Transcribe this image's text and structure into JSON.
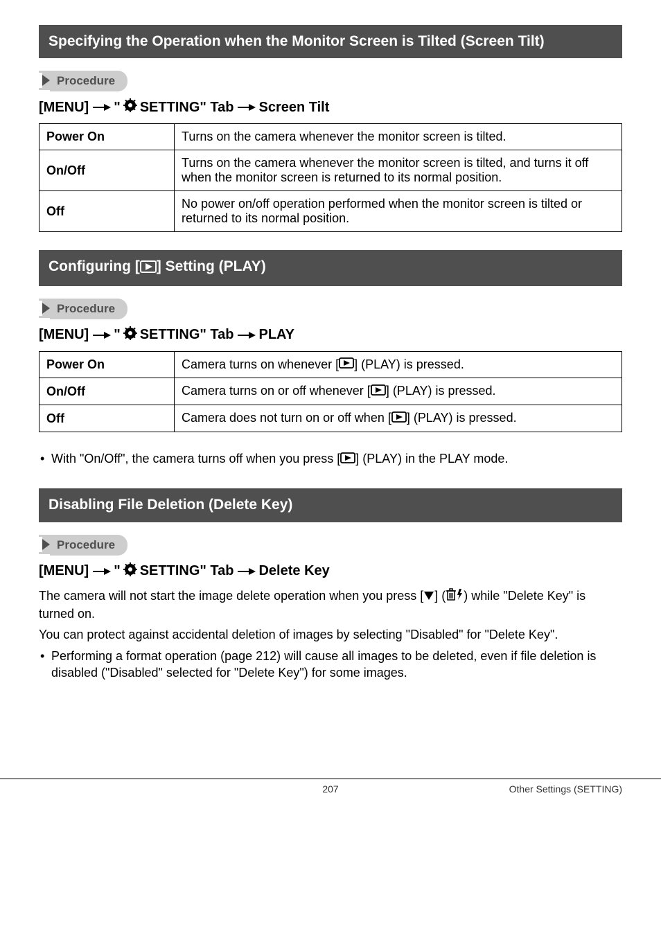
{
  "sec1": {
    "title": "Specifying the Operation when the Monitor Screen is Tilted (Screen Tilt)",
    "proc": "Procedure",
    "path_a": "[MENU]",
    "path_b": "\"",
    "path_c": " SETTING\" Tab",
    "path_d": "Screen Tilt",
    "rows": [
      {
        "k": "Power On",
        "v": "Turns on the camera whenever the monitor screen is tilted."
      },
      {
        "k": "On/Off",
        "v": "Turns on the camera whenever the monitor screen is tilted, and turns it off when the monitor screen is returned to its normal position."
      },
      {
        "k": "Off",
        "v": "No power on/off operation performed when the monitor screen is tilted or returned to its normal position."
      }
    ]
  },
  "sec2": {
    "title_a": "Configuring [",
    "title_b": "] Setting (PLAY)",
    "proc": "Procedure",
    "path_a": "[MENU]",
    "path_b": "\"",
    "path_c": " SETTING\" Tab",
    "path_d": "PLAY",
    "rows": [
      {
        "k": "Power On",
        "va": "Camera turns on whenever [",
        "vb": "] (PLAY) is pressed."
      },
      {
        "k": "On/Off",
        "va": "Camera turns on or off whenever [",
        "vb": "] (PLAY) is pressed."
      },
      {
        "k": "Off",
        "va": "Camera does not turn on or off when [",
        "vb": "] (PLAY) is pressed."
      }
    ],
    "note_a": "With \"On/Off\", the camera turns off when you press [",
    "note_b": "] (PLAY) in the PLAY mode."
  },
  "sec3": {
    "title": "Disabling File Deletion (Delete Key)",
    "proc": "Procedure",
    "path_a": "[MENU]",
    "path_b": "\"",
    "path_c": " SETTING\" Tab",
    "path_d": "Delete Key",
    "p1_a": "The camera will not start the image delete operation when you press [",
    "p1_b": "] (",
    "p1_c": ") while \"Delete Key\" is turned on.",
    "p2": "You can protect against accidental deletion of images by selecting \"Disabled\" for \"Delete Key\".",
    "bullet": "Performing a format operation (page 212) will cause all images to be deleted, even if file deletion is disabled (\"Disabled\" selected for \"Delete Key\") for some images."
  },
  "footer": {
    "page": "207",
    "section": "Other Settings (SETTING)"
  }
}
